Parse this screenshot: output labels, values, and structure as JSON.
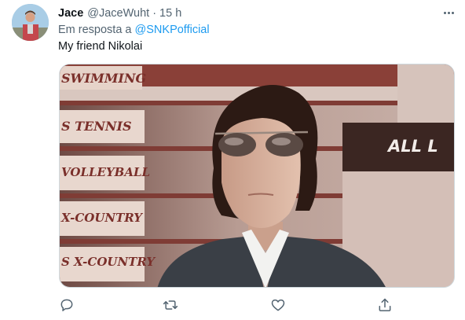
{
  "tweet": {
    "author_name": "Jace",
    "author_handle": "@JaceWuht",
    "separator": "·",
    "time": "15 h",
    "reply_prefix": "Em resposta a",
    "reply_to": "@SNKPofficial",
    "text": "My friend Nikolai"
  },
  "media": {
    "sign_rows": [
      "SWIMMING",
      "S TENNIS",
      "VOLLEYBALL",
      "X-COUNTRY",
      "S X-COUNTRY"
    ],
    "right_sign": "ALL L"
  },
  "icons": {
    "more": "more-horizontal-icon",
    "reply": "reply-icon",
    "retweet": "retweet-icon",
    "like": "heart-icon",
    "share": "share-icon"
  },
  "colors": {
    "link": "#1d9bf0",
    "secondary_text": "#536471",
    "primary_text": "#0f1419"
  }
}
